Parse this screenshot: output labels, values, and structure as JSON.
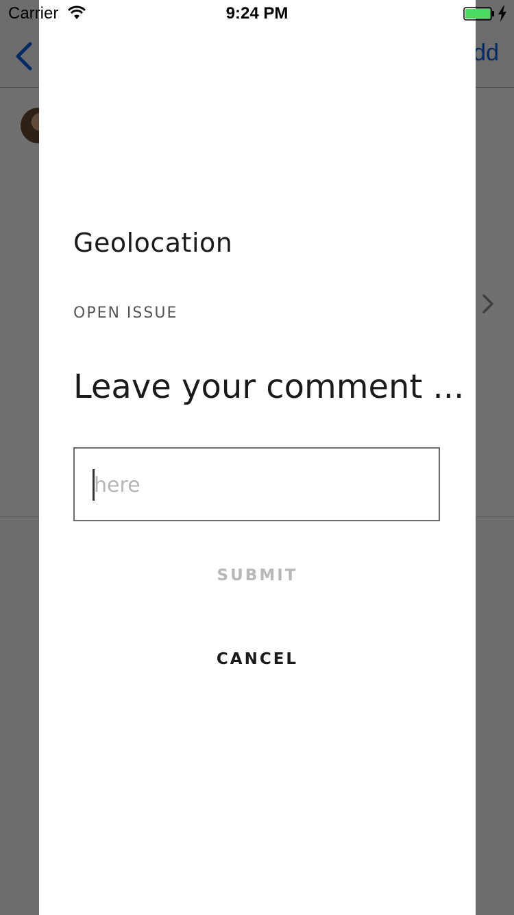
{
  "status_bar": {
    "carrier": "Carrier",
    "time": "9:24 PM"
  },
  "background": {
    "nav_right_label": "dd"
  },
  "modal": {
    "title": "Geolocation",
    "subtitle": "OPEN ISSUE",
    "prompt": "Leave your comment ...",
    "comment_placeholder": "here",
    "comment_value": "",
    "submit_label": "SUBMIT",
    "cancel_label": "CANCEL"
  },
  "colors": {
    "accent": "#0a5bdc",
    "battery": "#4cd964",
    "submit_disabled": "#b8b8b8",
    "text_primary": "#1a1a1a"
  }
}
